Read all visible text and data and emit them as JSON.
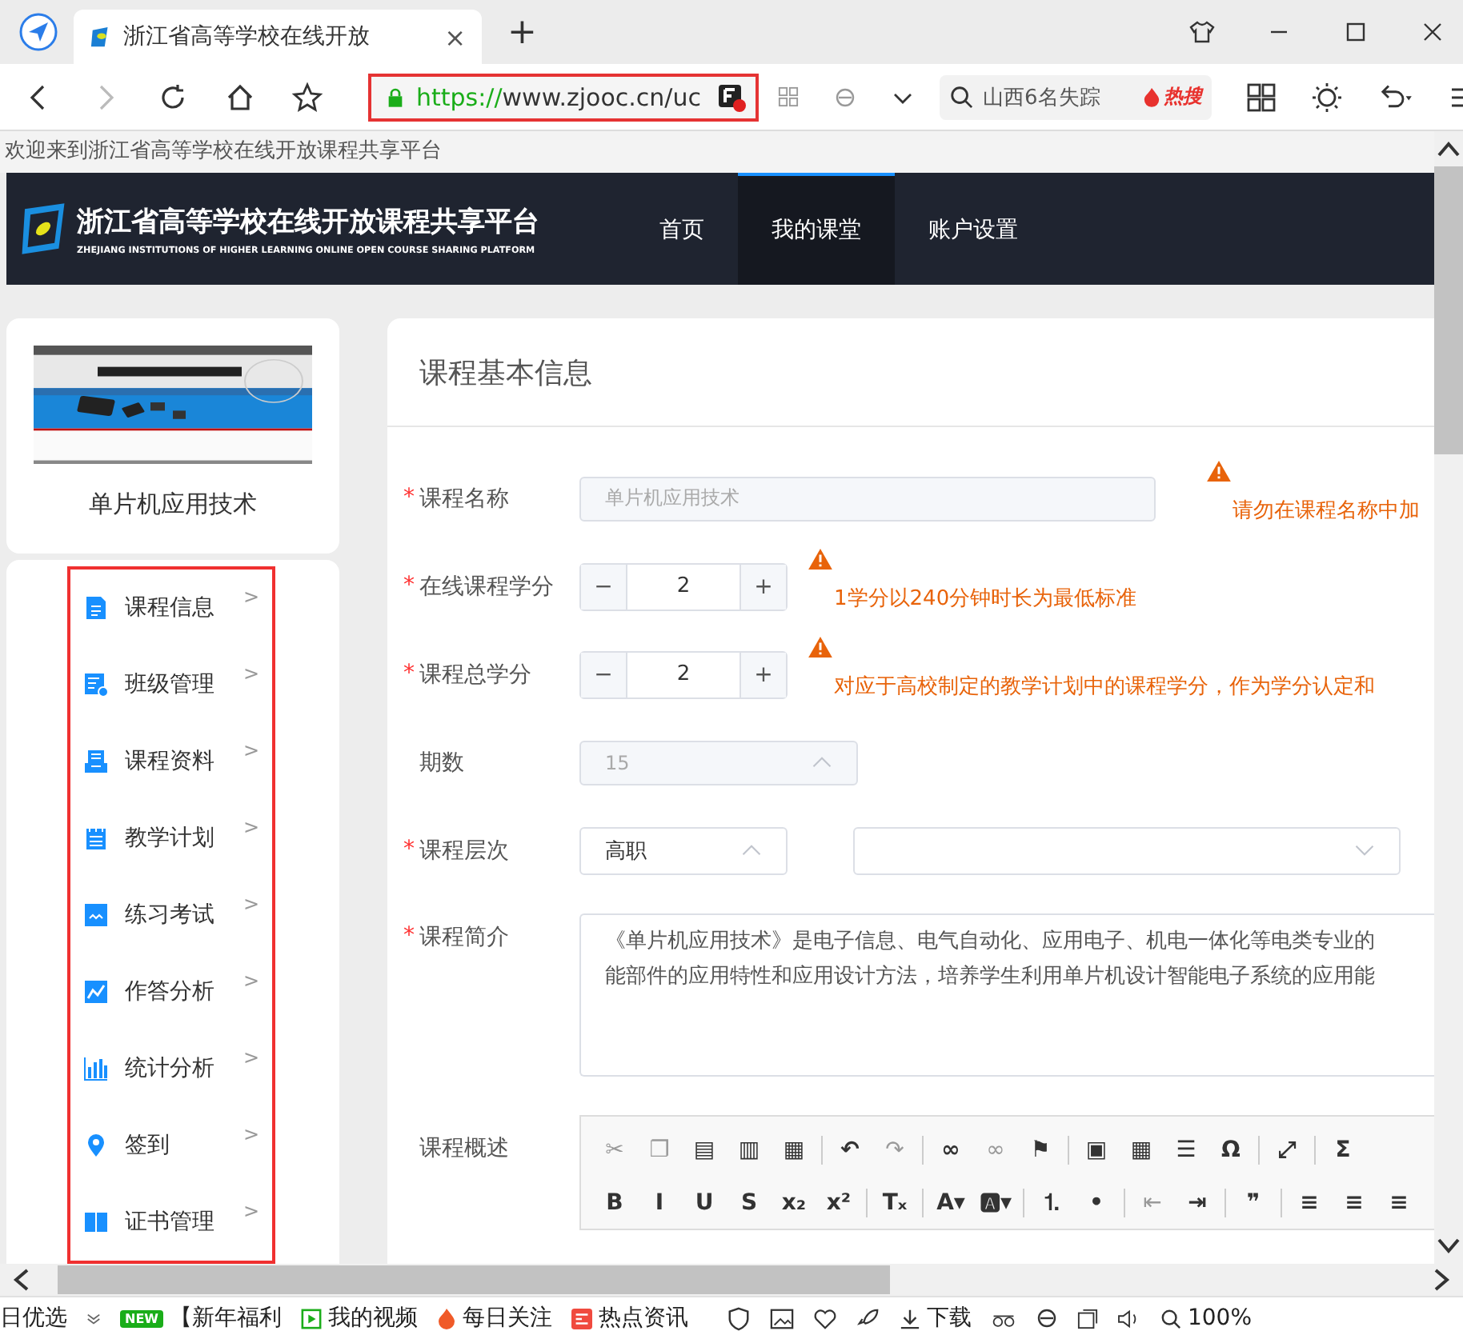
{
  "browser": {
    "tab_title": "浙江省高等学校在线开放",
    "tab_close": "×",
    "new_tab": "+",
    "url_scheme": "https://",
    "url_rest": "www.zjooc.cn/uc",
    "search_text": "山西6名失踪",
    "hot_label": "热搜"
  },
  "greeting": "欢迎来到浙江省高等学校在线开放课程共享平台",
  "site": {
    "title": "浙江省高等学校在线开放课程共享平台",
    "subtitle": "ZHEJIANG INSTITUTIONS OF HIGHER LEARNING ONLINE OPEN COURSE SHARING PLATFORM",
    "nav": [
      {
        "label": "首页",
        "selected": false
      },
      {
        "label": "我的课堂",
        "selected": true
      },
      {
        "label": "账户设置",
        "selected": false
      }
    ]
  },
  "course": {
    "name": "单片机应用技术"
  },
  "menu": [
    {
      "label": "课程信息",
      "chevron": ">"
    },
    {
      "label": "班级管理",
      "chevron": ">"
    },
    {
      "label": "课程资料",
      "chevron": ">"
    },
    {
      "label": "教学计划",
      "chevron": ">"
    },
    {
      "label": "练习考试",
      "chevron": ">"
    },
    {
      "label": "作答分析",
      "chevron": ">"
    },
    {
      "label": "统计分析",
      "chevron": ">"
    },
    {
      "label": "签到",
      "chevron": ">"
    },
    {
      "label": "证书管理",
      "chevron": ">"
    }
  ],
  "form": {
    "title": "课程基本信息",
    "fields": [
      {
        "kind": "text",
        "label": "课程名称",
        "required_mark": "*",
        "value": "单片机应用技术",
        "disabled": true,
        "warning": "请勿在课程名称中加"
      },
      {
        "kind": "stepper",
        "label": "在线课程学分",
        "required_mark": "*",
        "value": "2",
        "minus": "−",
        "plus": "+",
        "warning": "1学分以240分钟时长为最低标准"
      },
      {
        "kind": "stepper",
        "label": "课程总学分",
        "required_mark": "*",
        "value": "2",
        "minus": "−",
        "plus": "+",
        "warning": "对应于高校制定的教学计划中的课程学分，作为学分认定和"
      },
      {
        "kind": "select",
        "label": "期数",
        "value": "15",
        "disabled": true,
        "expanded": true
      },
      {
        "kind": "select_pair",
        "label": "课程层次",
        "required_mark": "*",
        "value": "高职",
        "expanded": true
      },
      {
        "kind": "textarea",
        "label": "课程简介",
        "required_mark": "*",
        "lines": [
          "《单片机应用技术》是电子信息、电气自动化、应用电子、机电一体化等电类专业的",
          "能部件的应用特性和应用设计方法，培养学生利用单片机设计智能电子系统的应用能"
        ]
      },
      {
        "kind": "editor",
        "label": "课程概述",
        "toolbar": [
          [
            {
              "glyph": "✂",
              "disabled": true
            },
            {
              "glyph": "❐",
              "disabled": true
            },
            {
              "glyph": "▤",
              "disabled": false
            },
            {
              "glyph": "▥",
              "disabled": false
            },
            {
              "glyph": "▦",
              "disabled": false
            },
            {
              "kind": "sep"
            },
            {
              "glyph": "↶",
              "disabled": false
            },
            {
              "glyph": "↷",
              "disabled": true
            },
            {
              "kind": "sep"
            },
            {
              "glyph": "∞",
              "disabled": false
            },
            {
              "glyph": "∞",
              "disabled": true
            },
            {
              "glyph": "⚑",
              "disabled": false
            },
            {
              "kind": "sep"
            },
            {
              "glyph": "▣",
              "disabled": false
            },
            {
              "glyph": "▦",
              "disabled": false
            },
            {
              "glyph": "☰",
              "disabled": false
            },
            {
              "glyph": "Ω",
              "disabled": false
            },
            {
              "kind": "sep"
            },
            {
              "glyph": "⤢",
              "disabled": false
            },
            {
              "kind": "sep"
            },
            {
              "glyph": "Σ",
              "disabled": false
            }
          ],
          [
            {
              "glyph": "B",
              "disabled": false
            },
            {
              "glyph": "I",
              "disabled": false
            },
            {
              "glyph": "U",
              "disabled": false
            },
            {
              "glyph": "S",
              "disabled": false
            },
            {
              "glyph": "x₂",
              "disabled": false
            },
            {
              "glyph": "x²",
              "disabled": false
            },
            {
              "kind": "sep"
            },
            {
              "glyph": "Tₓ",
              "disabled": false
            },
            {
              "kind": "sep"
            },
            {
              "glyph": "A▾",
              "disabled": false
            },
            {
              "glyph": "🅰▾",
              "disabled": false
            },
            {
              "kind": "sep"
            },
            {
              "glyph": "⒈",
              "disabled": false
            },
            {
              "glyph": "•",
              "disabled": false
            },
            {
              "kind": "sep"
            },
            {
              "glyph": "⇤",
              "disabled": true
            },
            {
              "glyph": "⇥",
              "disabled": false
            },
            {
              "kind": "sep"
            },
            {
              "glyph": "❞",
              "disabled": false
            },
            {
              "kind": "sep"
            },
            {
              "glyph": "≡",
              "disabled": false
            },
            {
              "glyph": "≡",
              "disabled": false
            },
            {
              "glyph": "≡",
              "disabled": false
            }
          ]
        ]
      }
    ]
  },
  "status_bar": {
    "items": [
      {
        "kind": "text",
        "label": "日优选"
      },
      {
        "kind": "new",
        "label": "【新年福利",
        "badge": "NEW"
      },
      {
        "kind": "video",
        "label": "我的视频"
      },
      {
        "kind": "fire",
        "label": "每日关注"
      },
      {
        "kind": "news",
        "label": "热点资讯"
      }
    ],
    "download": "下载",
    "zoom": "100%"
  }
}
